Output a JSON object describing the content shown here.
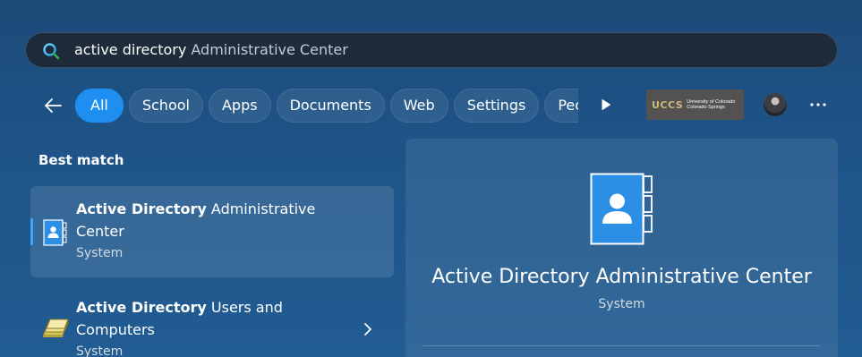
{
  "search": {
    "typed": "active directory",
    "suggestion": " Administrative Center",
    "icon": "search-icon"
  },
  "filters": {
    "back_icon": "back-arrow-icon",
    "chips": [
      "All",
      "School",
      "Apps",
      "Documents",
      "Web",
      "Settings",
      "People"
    ],
    "active": "All",
    "play_icon": "play-icon",
    "org_logo": {
      "abbr": "UCCS",
      "line1": "University of Colorado",
      "line2": "Colorado Springs"
    },
    "more_icon": "more-icon"
  },
  "results": {
    "section_title": "Best match",
    "items": [
      {
        "title_bold": "Active Directory",
        "title_rest": " Administrative Center",
        "subtitle": "System",
        "icon": "address-book-icon"
      },
      {
        "title_bold": "Active Directory",
        "title_rest": " Users and Computers",
        "subtitle": "System",
        "icon": "folder-users-icon"
      }
    ]
  },
  "detail": {
    "title": "Active Directory Administrative Center",
    "subtitle": "System",
    "icon": "address-book-icon"
  },
  "colors": {
    "accent": "#1e8ff0",
    "background": "#1e5488",
    "search_bg": "#1d2b3a"
  }
}
